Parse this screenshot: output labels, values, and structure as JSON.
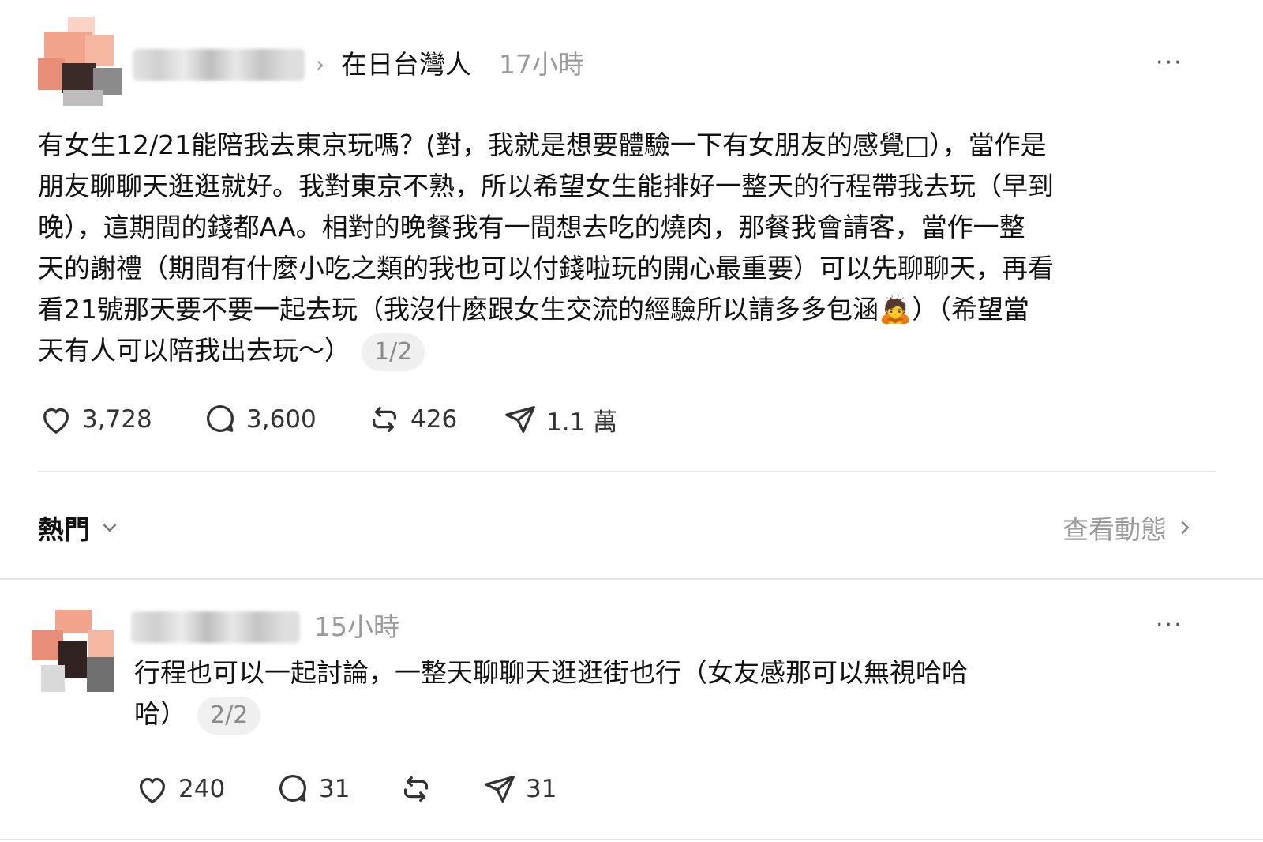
{
  "post": {
    "breadcrumb_sep": "›",
    "community": "在日台灣人",
    "time": "17小時",
    "more": "···",
    "lines": [
      "有女生12/21能陪我去東京玩嗎？(對，我就是想要體驗一下有女朋友的感覺□），當作是",
      "朋友聊聊天逛逛就好。我對東京不熟，所以希望女生能排好一整天的行程帶我去玩（早到",
      "晚），這期間的錢都AA。相對的晚餐我有一間想去吃的燒肉，那餐我會請客，當作一整",
      "天的謝禮（期間有什麼小吃之類的我也可以付錢啦玩的開心最重要）可以先聊聊天，再看",
      "看21號那天要不要一起去玩（我沒什麼跟女生交流的經驗所以請多多包涵",
      "天有人可以陪我出去玩～）"
    ],
    "emoji": "🙇",
    "line5_tail": "）（希望當",
    "page": "1/2",
    "likes": "3,728",
    "comments": "3,600",
    "reposts": "426",
    "shares": "1.1 萬"
  },
  "sort": {
    "label": "熱門",
    "activity": "查看動態"
  },
  "reply": {
    "time": "15小時",
    "more": "···",
    "lines": [
      "行程也可以一起討論，一整天聊聊天逛逛街也行（女友感那可以無視哈哈",
      "哈）"
    ],
    "page": "2/2",
    "likes": "240",
    "comments": "31",
    "shares": "31"
  },
  "colors": {
    "muted": "#9a9a9a",
    "divider": "#e3e3e3",
    "avatar_peach": "#f2a48c"
  }
}
